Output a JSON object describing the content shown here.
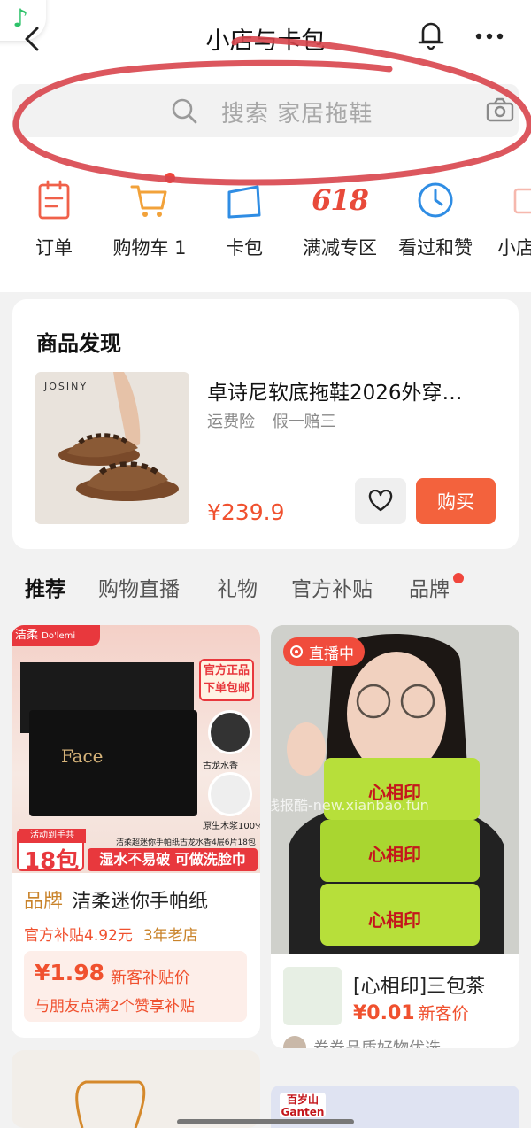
{
  "app": {
    "badge_icon": "music-note-icon"
  },
  "header": {
    "title": "小店与卡包"
  },
  "search": {
    "placeholder": "搜索 家居拖鞋"
  },
  "shortcuts": [
    {
      "label": "订单",
      "icon": "order-icon"
    },
    {
      "label": "购物车 1",
      "icon": "cart-icon"
    },
    {
      "label": "卡包",
      "icon": "card-wallet-icon"
    },
    {
      "label": "满减专区",
      "icon": "618-icon",
      "icon_text": "618"
    },
    {
      "label": "看过和赞",
      "icon": "clock-icon"
    },
    {
      "label": "小店",
      "icon": "store-icon"
    }
  ],
  "discovery": {
    "heading": "商品发现",
    "product": {
      "brand": "JOSINY",
      "name": "卓诗尼软底拖鞋2026外穿…",
      "tags": [
        "运费险",
        "假一赔三"
      ],
      "price": "¥239.9",
      "buy_label": "购买"
    }
  },
  "tabs": [
    "推荐",
    "购物直播",
    "礼物",
    "官方补贴",
    "品牌"
  ],
  "feed": {
    "item1": {
      "brand_tag": "品牌",
      "title": "洁柔迷你手帕纸",
      "subsidy": "官方补贴4.92元",
      "store_age": "3年老店",
      "price": "¥1.98",
      "price_note": "新客补贴价",
      "share_note": "与朋友点满2个赞享补贴",
      "image_texts": {
        "brand_top": "洁柔",
        "brand_top2": "Do'lemi",
        "official": "官方正品",
        "ship": "下单包邮",
        "scent": "古龙水香",
        "pulp": "原生木浆100%",
        "event": "活动到手共",
        "count": "18包",
        "slogan": "湿水不易破 可做洗脸巾",
        "desc": "洁柔超迷你手帕纸古龙水香4层6片18包",
        "face": "Face"
      }
    },
    "item2": {
      "live_label": "直播中",
      "title": "[心相印]三包茶",
      "price": "¥0.01",
      "price_note": "新客价",
      "shop": "卷卷品质好物优选",
      "watermark": "线报酷-new.xianbao.fun",
      "pack_brand": "心相印"
    },
    "item4": {
      "logo": "百岁山 Ganten"
    }
  },
  "colors": {
    "accent": "#f3623d",
    "price": "#f0512f",
    "annotation": "#d8454c"
  }
}
